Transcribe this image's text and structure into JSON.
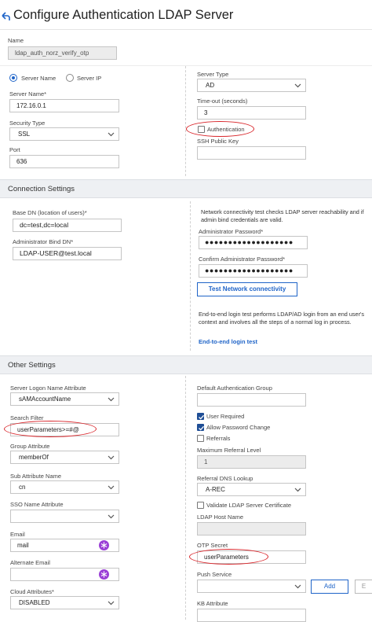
{
  "header": {
    "title": "Configure Authentication LDAP Server"
  },
  "general": {
    "name_label": "Name",
    "name_value": "ldap_auth_norz_verify_otp",
    "radio_server_name": "Server Name",
    "radio_server_ip": "Server IP",
    "server_name_label": "Server Name*",
    "server_name_value": "172.16.0.1",
    "security_type_label": "Security Type",
    "security_type_value": "SSL",
    "port_label": "Port",
    "port_value": "636",
    "server_type_label": "Server Type",
    "server_type_value": "AD",
    "timeout_label": "Time-out (seconds)",
    "timeout_value": "3",
    "authentication_label": "Authentication",
    "ssh_key_label": "SSH Public Key"
  },
  "connection": {
    "section_title": "Connection Settings",
    "base_dn_label": "Base DN (location of users)*",
    "base_dn_value": "dc=test,dc=local",
    "admin_bind_label": "Administrator Bind DN*",
    "admin_bind_value": "LDAP-USER@test.local",
    "connectivity_note": "Network connectivity test checks LDAP server reachability and if admin bind credentials are valid.",
    "admin_password_label": "Administrator Password*",
    "admin_password_value": "●●●●●●●●●●●●●●●●●●●",
    "confirm_password_label": "Confirm Administrator Password*",
    "confirm_password_value": "●●●●●●●●●●●●●●●●●●●",
    "test_button": "Test Network connectivity",
    "e2e_note": "End-to-end login test performs LDAP/AD login from an end user's context and involves all the steps of a normal log in process.",
    "e2e_link": "End-to-end login test"
  },
  "other": {
    "section_title": "Other Settings",
    "logon_attr_label": "Server Logon Name Attribute",
    "logon_attr_value": "sAMAccountName",
    "search_filter_label": "Search Filter",
    "search_filter_value": "userParameters>=#@",
    "group_attr_label": "Group Attribute",
    "group_attr_value": "memberOf",
    "sub_attr_label": "Sub Attribute Name",
    "sub_attr_value": "cn",
    "sso_attr_label": "SSO Name Attribute",
    "email_label": "Email",
    "email_value": "mail",
    "alt_email_label": "Alternate Email",
    "cloud_attr_label": "Cloud Attributes*",
    "cloud_attr_value": "DISABLED",
    "default_group_label": "Default Authentication Group",
    "user_required_label": "User Required",
    "allow_pwd_change_label": "Allow Password Change",
    "referrals_label": "Referrals",
    "max_referral_label": "Maximum Referral Level",
    "max_referral_value": "1",
    "referral_dns_label": "Referral DNS Lookup",
    "referral_dns_value": "A-REC",
    "validate_cert_label": "Validate LDAP Server Certificate",
    "ldap_host_label": "LDAP Host Name",
    "otp_secret_label": "OTP Secret",
    "otp_secret_value": "userParameters",
    "push_service_label": "Push Service",
    "add_button": "Add",
    "edit_button": "E",
    "kb_attr_label": "KB Attribute"
  },
  "colors": {
    "accent": "#1f64c8",
    "highlight": "#d9262b",
    "key_icon": "#9a3fd6"
  }
}
